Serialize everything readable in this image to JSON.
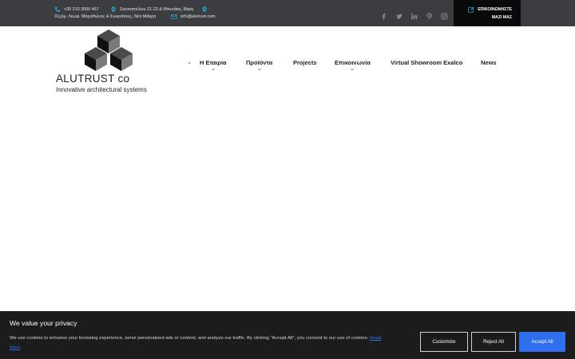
{
  "topbar": {
    "phone": "+30 210 3000 467",
    "address1": "Σαυτοπούλου 21-23 & Μπενάκη, Βάρη",
    "address2": "31χλμ. Λεωφ. Μαραθώνος & Σωκράτους, Νέα Μάκρη",
    "email": "info@alutrust.com",
    "social": [
      "facebook-icon",
      "twitter-icon",
      "linkedin-icon",
      "pinterest-icon",
      "instagram-icon"
    ],
    "contact_line1": "ΕΠΙΚΟΙΝΩΝΗΣΤΕ",
    "contact_line2": "ΜΑΖΙ ΜΑΣ"
  },
  "logo": {
    "title": "ALUTRUST co",
    "subtitle": "Innovative architectural systems"
  },
  "nav": {
    "items": [
      {
        "label": "Η Εταιρία",
        "dropdown": true
      },
      {
        "label": "Προϊόντα",
        "dropdown": true
      },
      {
        "label": "Projects",
        "dropdown": false
      },
      {
        "label": "Επικοινωνία",
        "dropdown": true
      },
      {
        "label": "Virtual Showroom Exalco",
        "dropdown": false
      },
      {
        "label": "News",
        "dropdown": false
      }
    ]
  },
  "cookie": {
    "title": "We value your privacy",
    "text": "We use cookies to enhance your browsing experience, serve personalized ads or content, and analyze our traffic. By clicking \"Accept All\", you consent to our use of cookies.",
    "read_more": "Read More",
    "customize": "Customize",
    "reject": "Reject All",
    "accept": "Accept All"
  },
  "colors": {
    "topbar": "#3b3d40",
    "icon_accent": "#2aa0c8",
    "cookie_bg": "#1c1c1c",
    "accept_blue": "#2f6fed"
  }
}
